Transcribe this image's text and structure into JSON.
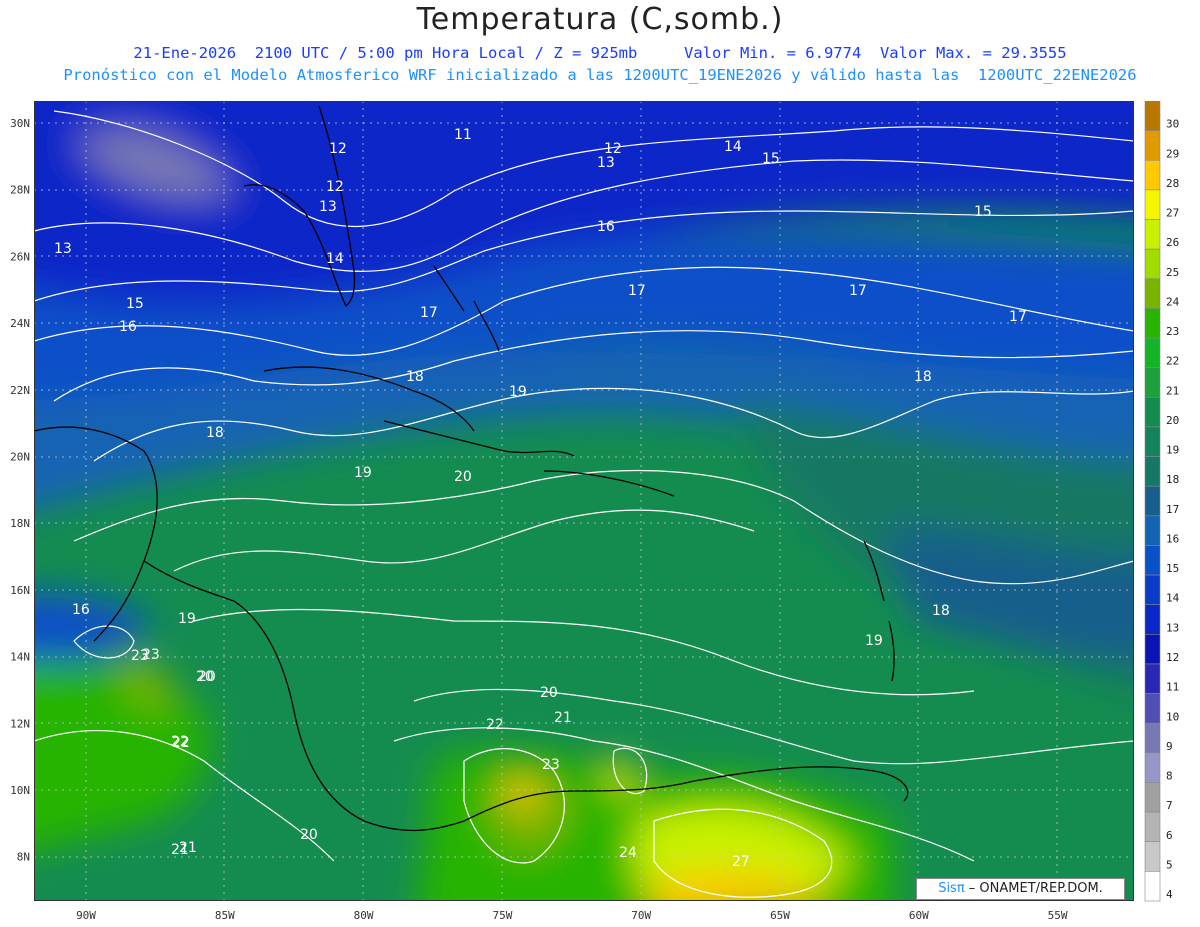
{
  "title": "Temperatura (C,somb.)",
  "subtitle_line1": "21-Ene-2026  2100 UTC / 5:00 pm Hora Local / Z = 925mb     Valor Min. = 6.9774  Valor Max. = 29.3555",
  "subtitle_line2": "Pronóstico con el Modelo Atmosferico WRF inicializado a las 1200UTC_19ENE2026 y válido hasta las  1200UTC_22ENE2026",
  "credit": {
    "logo": "Sisπ",
    "text": " – ONAMET/REP.DOM."
  },
  "axes": {
    "lat_labels": [
      "30N",
      "28N",
      "26N",
      "24N",
      "22N",
      "20N",
      "18N",
      "16N",
      "14N",
      "12N",
      "10N",
      "8N"
    ],
    "lon_labels": [
      "90W",
      "85W",
      "80W",
      "75W",
      "70W",
      "65W",
      "60W",
      "55W"
    ]
  },
  "colorbar": {
    "labels": [
      "30",
      "29",
      "28",
      "27",
      "26",
      "25",
      "24",
      "23",
      "22",
      "21",
      "20",
      "19",
      "18",
      "17",
      "16",
      "15",
      "14",
      "13",
      "12",
      "11",
      "10",
      "9",
      "8",
      "7",
      "6",
      "5",
      "4"
    ],
    "colors": [
      "#b87800",
      "#e19a00",
      "#ffc800",
      "#f5f500",
      "#c8f000",
      "#a0dc00",
      "#78b400",
      "#28b400",
      "#14b428",
      "#1ea03c",
      "#148c50",
      "#14825a",
      "#147864",
      "#145f8c",
      "#1464b4",
      "#0a50c8",
      "#0a3cc8",
      "#0a28c8",
      "#0a14b4",
      "#2828b4",
      "#5050b4",
      "#7878b4",
      "#9696c8",
      "#a0a0a0",
      "#b4b4b4",
      "#c8c8c8",
      "#ffffff"
    ]
  },
  "contour_labels": [
    "11",
    "12",
    "12",
    "13",
    "14",
    "15",
    "12",
    "13",
    "13",
    "14",
    "15",
    "16",
    "17",
    "17",
    "17",
    "16",
    "15",
    "17",
    "18",
    "18",
    "18",
    "19",
    "19",
    "20",
    "20",
    "21",
    "22",
    "22",
    "23",
    "20",
    "21",
    "23",
    "24",
    "27",
    "18",
    "19",
    "16",
    "19",
    "23",
    "20",
    "22",
    "20",
    "21"
  ]
}
